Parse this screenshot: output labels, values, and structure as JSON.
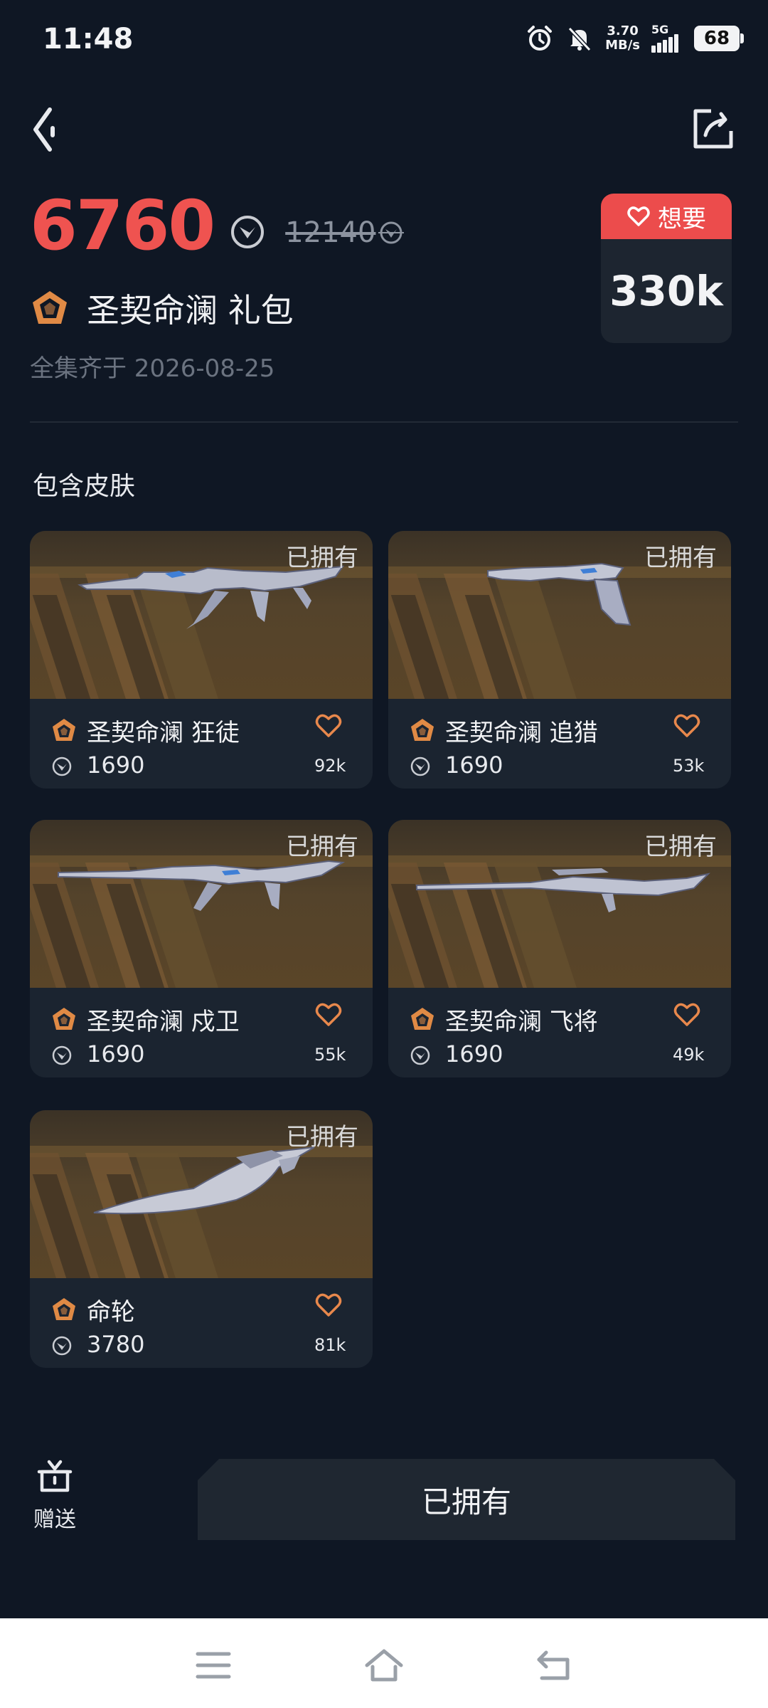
{
  "status_bar": {
    "time": "11:48",
    "net_speed_value": "3.70",
    "net_speed_unit": "MB/s",
    "network": "5G",
    "battery": "68"
  },
  "header": {
    "icons": [
      "back-chevron-icon",
      "share-icon"
    ]
  },
  "bundle": {
    "price": "6760",
    "original_price": "12140",
    "name": "圣契命澜 礼包",
    "collect_date": "全集齐于 2026-08-25",
    "want_label": "想要",
    "want_count": "330k"
  },
  "section": {
    "title": "包含皮肤"
  },
  "skins": [
    {
      "owned": "已拥有",
      "name": "圣契命澜 狂徒",
      "price": "1690",
      "likes": "92k"
    },
    {
      "owned": "已拥有",
      "name": "圣契命澜 追猎",
      "price": "1690",
      "likes": "53k"
    },
    {
      "owned": "已拥有",
      "name": "圣契命澜 戍卫",
      "price": "1690",
      "likes": "55k"
    },
    {
      "owned": "已拥有",
      "name": "圣契命澜 飞将",
      "price": "1690",
      "likes": "49k"
    },
    {
      "owned": "已拥有",
      "name": "命轮",
      "price": "3780",
      "likes": "81k"
    }
  ],
  "actions": {
    "gift_label": "赠送",
    "owned_button": "已拥有"
  },
  "colors": {
    "background": "#0f1724",
    "card": "#1b2430",
    "price_red": "#ef5350",
    "want_red": "#ec4c4c",
    "tier_orange": "#e08a45",
    "heart_orange": "#e8884c"
  }
}
